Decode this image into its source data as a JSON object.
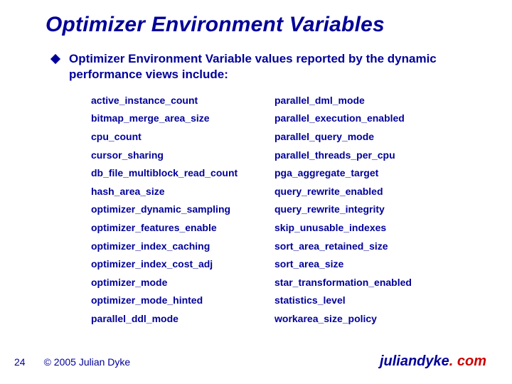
{
  "title": "Optimizer Environment Variables",
  "lead": "Optimizer Environment Variable values reported by the dynamic performance views include:",
  "table": {
    "col1": [
      "active_instance_count",
      "bitmap_merge_area_size",
      "cpu_count",
      "cursor_sharing",
      "db_file_multiblock_read_count",
      "hash_area_size",
      "optimizer_dynamic_sampling",
      "optimizer_features_enable",
      "optimizer_index_caching",
      "optimizer_index_cost_adj",
      "optimizer_mode",
      "optimizer_mode_hinted",
      "parallel_ddl_mode"
    ],
    "col2": [
      "parallel_dml_mode",
      "parallel_execution_enabled",
      "parallel_query_mode",
      "parallel_threads_per_cpu",
      "pga_aggregate_target",
      "query_rewrite_enabled",
      "query_rewrite_integrity",
      "skip_unusable_indexes",
      "sort_area_retained_size",
      "sort_area_size",
      "star_transformation_enabled",
      "statistics_level",
      "workarea_size_policy"
    ]
  },
  "footer": {
    "page": "24",
    "copyright": "© 2005 Julian Dyke",
    "site_name": "juliandyke",
    "site_dot": ". ",
    "site_tld": "com"
  }
}
